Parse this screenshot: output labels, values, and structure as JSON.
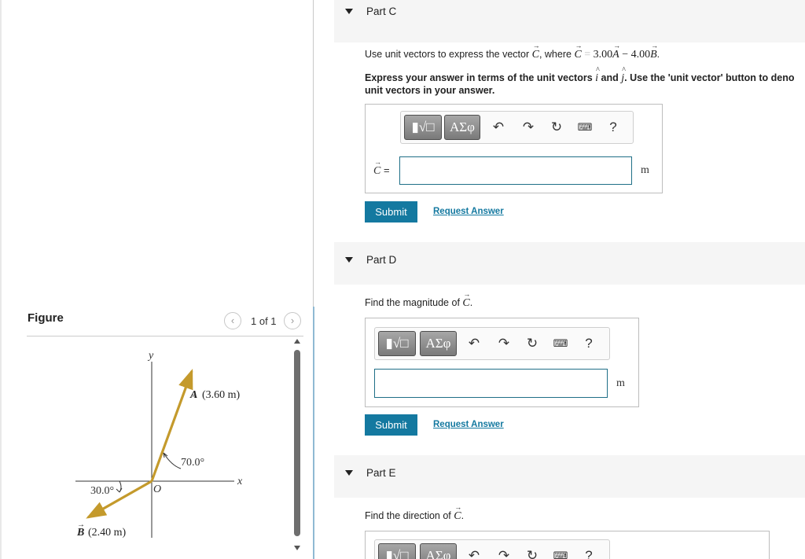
{
  "figure_panel": {
    "title": "Figure",
    "pager": "1 of 1",
    "prev_icon": "chevron-left-icon",
    "next_icon": "chevron-right-icon",
    "labels": {
      "y_axis": "y",
      "x_axis": "x",
      "origin": "O",
      "vector_a_letter": "A",
      "vector_a_magnitude": "(3.60 m)",
      "vector_b_letter": "B",
      "vector_b_magnitude": "(2.40 m)",
      "angle_a": "70.0°",
      "angle_b": "30.0°"
    },
    "colors": {
      "vector": "#c49a2c"
    }
  },
  "part_c": {
    "title": "Part C",
    "q_prefix": "Use unit vectors to express the vector",
    "q_c_sym": "C",
    "q_where": ", where",
    "q_c_sym2": "C",
    "q_eq": "=",
    "q_coef_a": "3.00",
    "q_a_sym": "A",
    "q_minus": "− 4.00",
    "q_b_sym": "B",
    "q_end": ".",
    "instr_1": "Express your answer in terms of the unit vectors",
    "instr_i": "i",
    "instr_and": "and",
    "instr_j": "j",
    "instr_2": ". Use the 'unit vector' button to deno",
    "instr_3": "unit vectors in your answer.",
    "var_sym": "C",
    "var_eq": "=",
    "input_value": "",
    "unit": "m",
    "submit": "Submit",
    "request": "Request Answer"
  },
  "part_d": {
    "title": "Part D",
    "question": "Find the magnitude of",
    "q_sym": "C",
    "q_end": ".",
    "input_value": "",
    "unit": "m",
    "submit": "Submit",
    "request": "Request Answer"
  },
  "part_e": {
    "title": "Part E",
    "question": "Find the direction of",
    "q_sym": "C",
    "q_end": "."
  },
  "toolbar": {
    "templates_icon": "templates-icon",
    "symbols_label": "ΑΣφ",
    "undo_icon": "undo-icon",
    "redo_icon": "redo-icon",
    "reset_icon": "reset-icon",
    "keyboard_icon": "keyboard-icon",
    "help_label": "?"
  },
  "colors": {
    "accent": "#1479a0",
    "header_bg": "#f5f5f5",
    "input_border": "#1f6f87"
  }
}
